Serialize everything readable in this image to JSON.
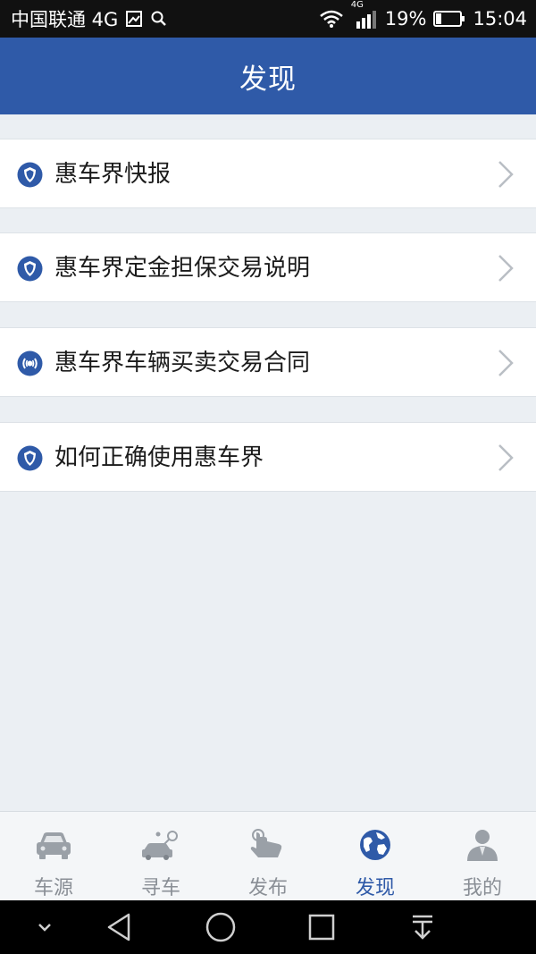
{
  "status_bar": {
    "carrier": "中国联通 4G",
    "network_badge": "4G",
    "battery": "19%",
    "time": "15:04"
  },
  "header": {
    "title": "发现"
  },
  "list": {
    "items": [
      {
        "label": "惠车界快报",
        "icon": "shield-icon"
      },
      {
        "label": "惠车界定金担保交易说明",
        "icon": "shield-icon"
      },
      {
        "label": "惠车界车辆买卖交易合同",
        "icon": "broadcast-icon"
      },
      {
        "label": "如何正确使用惠车界",
        "icon": "shield-icon"
      }
    ]
  },
  "tabs": [
    {
      "label": "车源",
      "icon": "car-icon",
      "active": false
    },
    {
      "label": "寻车",
      "icon": "car-search-icon",
      "active": false
    },
    {
      "label": "发布",
      "icon": "hand-tap-icon",
      "active": false
    },
    {
      "label": "发现",
      "icon": "globe-icon",
      "active": true
    },
    {
      "label": "我的",
      "icon": "user-icon",
      "active": false
    }
  ],
  "colors": {
    "accent": "#2f5aa8",
    "background": "#ebeff3",
    "inactive_tab": "#8a8f96"
  }
}
